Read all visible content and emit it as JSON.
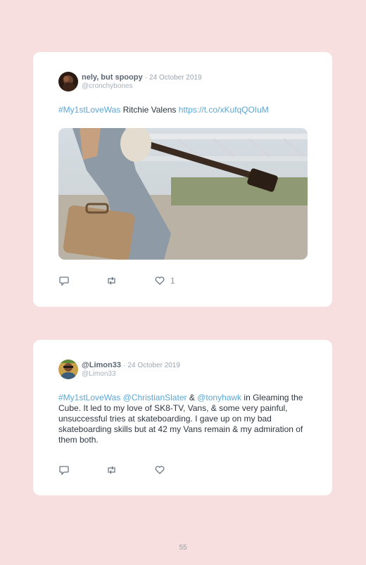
{
  "tweets": [
    {
      "display_name": "nely, but spoopy",
      "separator": "·",
      "date": "24 October 2019",
      "handle": "@cronchybones",
      "hashtag": "#My1stLoveWas",
      "text_main": " Ritchie Valens ",
      "link": "https://t.co/xKufqQOIuM",
      "media": "image",
      "like_count": "1"
    },
    {
      "display_name": "@Limon33",
      "separator": "·",
      "date": "24 October 2019",
      "handle": "@Limon33",
      "hashtag": "#My1stLoveWas",
      "space1": " ",
      "mention1": "@ChristianSlater",
      "amp": " & ",
      "mention2": "@tonyhawk",
      "text_rest": " in Gleaming the Cube. It led to my love of SK8-TV, Vans, & some very painful, unsuccessful tries at skateboarding. I gave up on my bad skateboarding skills but at 42 my Vans remain & my admiration of them both."
    }
  ],
  "page_number": "55",
  "colors": {
    "background": "#f7dfdf",
    "card": "#ffffff",
    "link": "#5aa7d6",
    "text": "#2e3640"
  },
  "icons": [
    "reply-icon",
    "retweet-icon",
    "like-icon"
  ]
}
